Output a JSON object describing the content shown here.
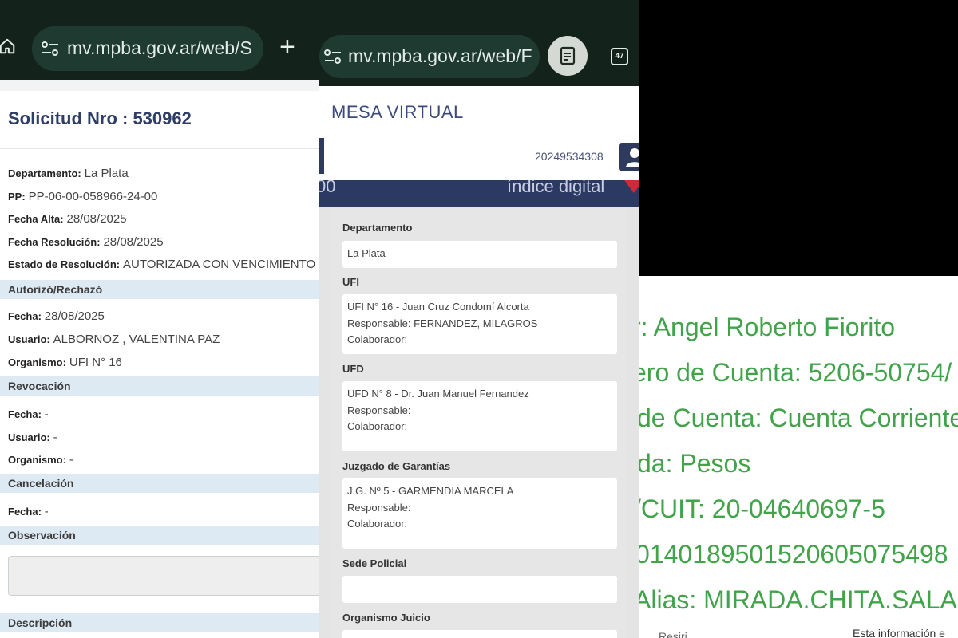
{
  "panel1": {
    "browser": {
      "url": "mv.mpba.gov.ar/web/S"
    },
    "title": "Solicitud Nro : 530962",
    "fields": [
      {
        "label": "Departamento:",
        "value": "La Plata"
      },
      {
        "label": "PP:",
        "value": "PP-06-00-058966-24-00"
      },
      {
        "label": "Fecha Alta:",
        "value": "28/08/2025"
      },
      {
        "label": "Fecha Resolución:",
        "value": "28/08/2025"
      },
      {
        "label": "Estado de Resolución:",
        "value": "AUTORIZADA CON VENCIMIENTO"
      }
    ],
    "autorizo": {
      "heading": "Autorizó/Rechazó",
      "fields": [
        {
          "label": "Fecha:",
          "value": "28/08/2025"
        },
        {
          "label": "Usuario:",
          "value": "ALBORNOZ , VALENTINA PAZ"
        },
        {
          "label": "Organismo:",
          "value": "UFI N° 16"
        }
      ]
    },
    "revocacion": {
      "heading": "Revocación",
      "fields": [
        {
          "label": "Fecha:",
          "value": "-"
        },
        {
          "label": "Usuario:",
          "value": "-"
        },
        {
          "label": "Organismo:",
          "value": "-"
        }
      ]
    },
    "cancelacion": {
      "heading": "Cancelación",
      "fields": [
        {
          "label": "Fecha:",
          "value": "-"
        }
      ]
    },
    "observacion": {
      "heading": "Observación"
    },
    "descripcion": {
      "heading": "Descripción"
    }
  },
  "panel2": {
    "browser": {
      "url": "mv.mpba.gov.ar/web/F",
      "tab_count": "47"
    },
    "app_name": "MESA VIRTUAL",
    "user_id": "20249534308",
    "banner": {
      "number_fragment": "00",
      "index_label": "índice digital"
    },
    "sections": [
      {
        "label": "Departamento",
        "lines": [
          "La Plata"
        ]
      },
      {
        "label": "UFI",
        "lines": [
          "UFI N° 16 - Juan Cruz Condomí Alcorta",
          "Responsable: FERNANDEZ, MILAGROS",
          "Colaborador:"
        ]
      },
      {
        "label": "UFD",
        "lines": [
          "UFD N° 8 - Dr. Juan Manuel Fernandez",
          "Responsable:",
          "Colaborador:"
        ]
      },
      {
        "label": "Juzgado de Garantías",
        "lines": [
          "J.G. Nº 5 - GARMENDIA MARCELA",
          "Responsable:",
          "Colaborador:"
        ]
      },
      {
        "label": "Sede Policial",
        "lines": [
          "-"
        ]
      },
      {
        "label": "Organismo Juicio",
        "lines": []
      }
    ]
  },
  "panel3": {
    "lines": [
      "r: Angel Roberto Fiorito",
      "ero de Cuenta: 5206-50754/",
      "de Cuenta: Cuenta Corriente",
      "da: Pesos",
      "/CUIT: 20-04640697-5",
      "0140189501520605075498",
      "Alias: MIRADA.CHITA.SALA"
    ],
    "footer_left": "Resiri...",
    "footer_right": "Esta información e"
  }
}
